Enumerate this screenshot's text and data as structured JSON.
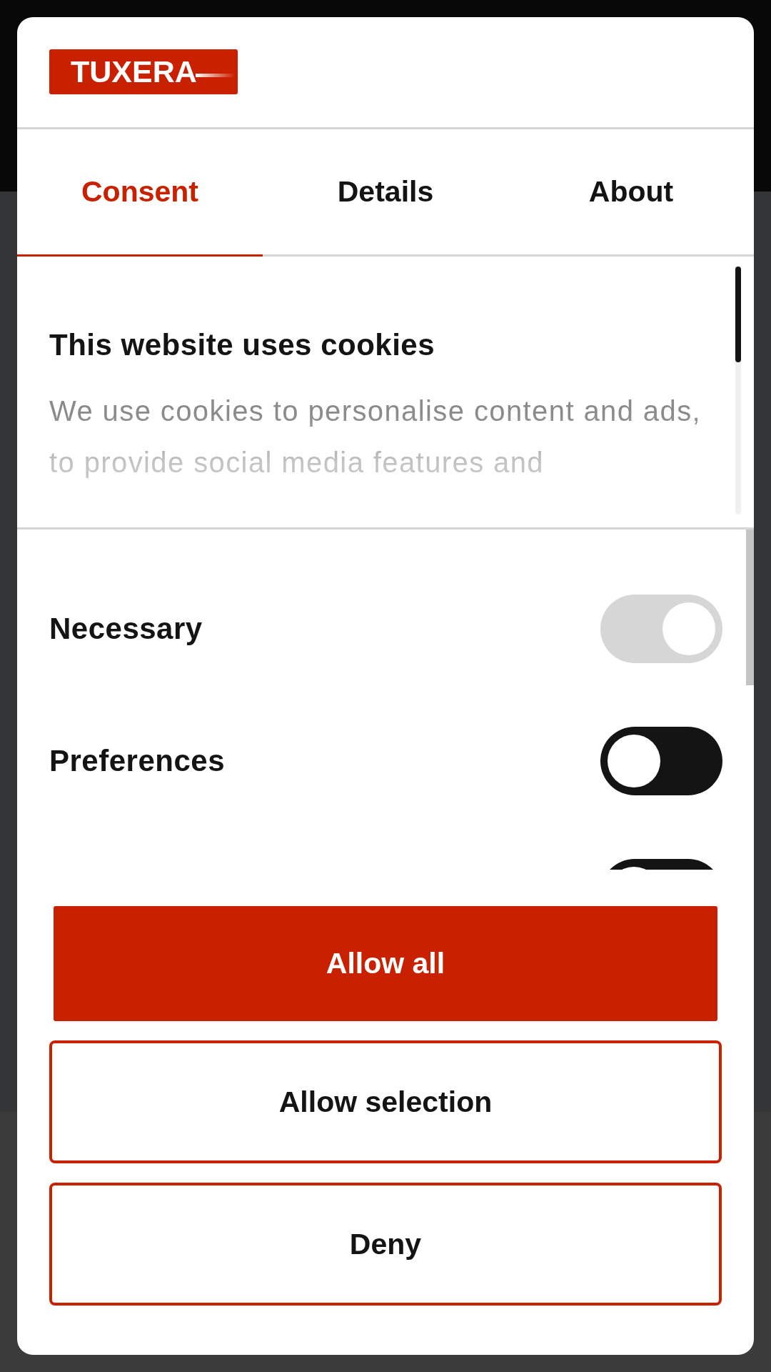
{
  "logo": {
    "text": "TUXERA"
  },
  "tabs": [
    {
      "label": "Consent",
      "selected": true
    },
    {
      "label": "Details",
      "selected": false
    },
    {
      "label": "About",
      "selected": false
    }
  ],
  "intro": {
    "title": "This website uses cookies",
    "body": "We use cookies to personalise content and ads, to provide social media features and"
  },
  "categories": [
    {
      "label": "Necessary",
      "checked": true,
      "disabled": true
    },
    {
      "label": "Preferences",
      "checked": false,
      "disabled": false
    },
    {
      "checked": false,
      "disabled": false
    }
  ],
  "buttons": [
    {
      "label": "Allow all",
      "kind": "primary"
    },
    {
      "label": "Allow selection",
      "kind": "outline"
    },
    {
      "label": "Deny",
      "kind": "outline"
    }
  ]
}
